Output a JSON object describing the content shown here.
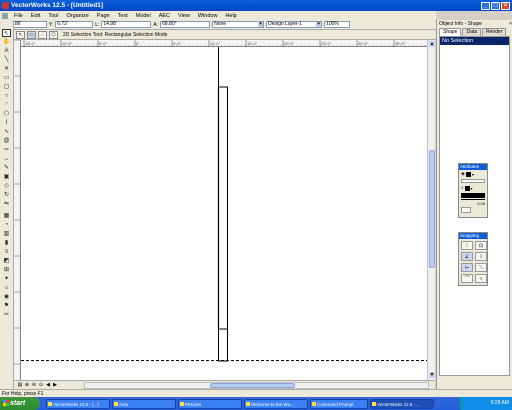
{
  "window": {
    "title": "VectorWorks 12.5 - [Untitled1]",
    "minimize_icon": "minimize-icon",
    "maximize_icon": "maximize-icon",
    "close_icon": "close-icon"
  },
  "menu": [
    "File",
    "Edit",
    "Tool",
    "Organize",
    "Page",
    "Text",
    "Model",
    "AEC",
    "View",
    "Window",
    "Help"
  ],
  "databar": {
    "x_label": "X:",
    "x_value": "4.86'",
    "y_label": "Y:",
    "y_value": "6.72'",
    "l_label": "L:",
    "l_value": "14.98'",
    "a_label": "A:",
    "a_value": "68.80°",
    "class_value": "None",
    "layer_value": "Design Layer-1",
    "zoom_value": "100%"
  },
  "modebar": {
    "mode_text": "2D Selection Tool: Rectangular Selection Mode"
  },
  "ruler": {
    "h_ticks": [
      "15'-0\"",
      "10'-0\"",
      "5'-0\"",
      "0'",
      "5'-0\"",
      "10'-0\"",
      "15'-0\"",
      "20'-0\"",
      "25'-0\"",
      "30'-0\"",
      "35'-0\""
    ]
  },
  "status": {
    "text": "For Help, press F1"
  },
  "oip": {
    "title": "Object Info - Shape",
    "tabs": [
      "Shape",
      "Data",
      "Render"
    ],
    "selection": "No Selection"
  },
  "attributes_palette": {
    "title": "Attributes",
    "value": "0.05"
  },
  "snapping_palette": {
    "title": "Snapping"
  },
  "taskbar": {
    "start": "start",
    "tasks": [
      "VectorWorks 12.5 - [...]",
      "Auto",
      "Pictures",
      "Welcome to the Wo...",
      "Command Prompt",
      "VectorWorks 12.5 - ..."
    ],
    "clock": "9:28 AM"
  }
}
